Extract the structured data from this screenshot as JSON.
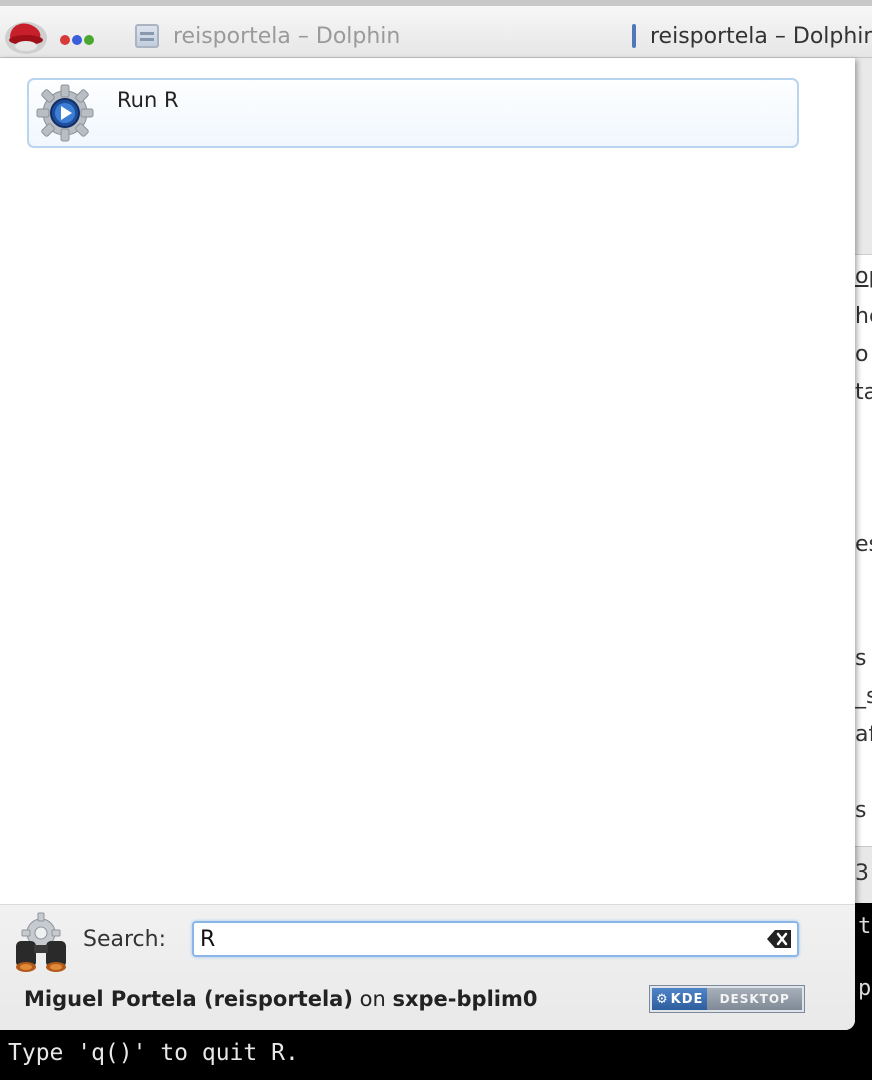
{
  "taskbar": {
    "tasks": [
      {
        "title": "reisportela – Dolphin",
        "icon": "dolphin-icon",
        "active": false
      },
      {
        "title": "reisportela – Dolphin",
        "icon": "dolphin-icon",
        "active": true
      }
    ],
    "pager_colors": [
      "#d83a3a",
      "#3a5fd8",
      "#4aa82e"
    ]
  },
  "background": {
    "fragments": [
      "op",
      "he",
      "o",
      "ta",
      "es",
      "s",
      "_s",
      "af",
      "s"
    ],
    "status_fragment": "3",
    "terminal_fragments": [
      "t",
      "p"
    ],
    "terminal_line": "Type 'q()' to quit R."
  },
  "krunner": {
    "results": [
      {
        "label": "Run R",
        "icon": "run-command-gear-icon"
      }
    ],
    "search": {
      "label": "Search:",
      "value": "R"
    },
    "user": {
      "name": "Miguel Portela (reisportela)",
      "on": "on",
      "host": "sxpe-bplim0"
    },
    "badge": {
      "left": "KDE",
      "right": "DESKTOP"
    }
  },
  "colors": {
    "selection_border": "#b9d4ef",
    "search_focus": "#8bb7e8"
  }
}
